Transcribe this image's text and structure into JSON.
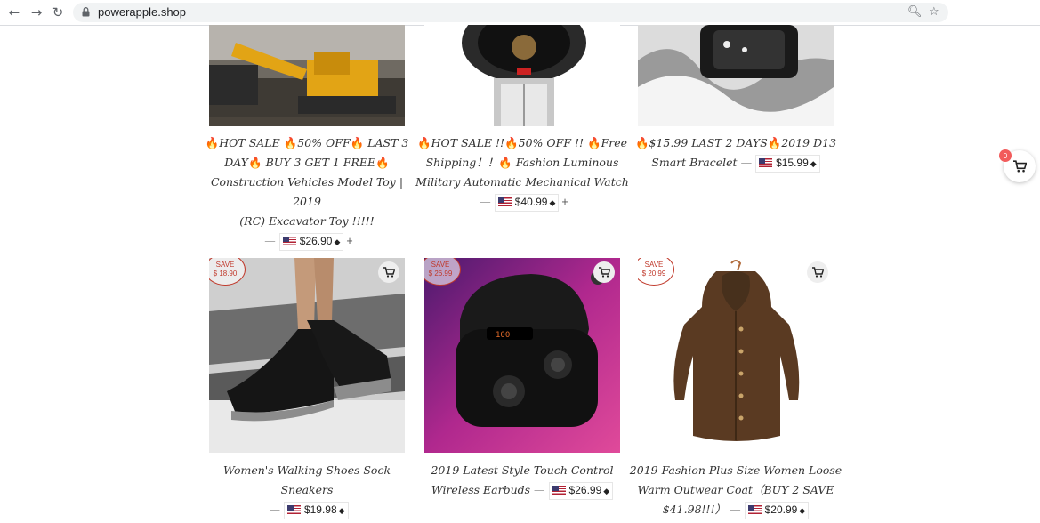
{
  "browser": {
    "url": "powerapple.shop"
  },
  "cart": {
    "count": "0"
  },
  "products": [
    {
      "title": "HOT SALE 50% OFF LAST 3 DAY BUY 3 GET 1 FREE Construction Vehicles Model Toy | 2019 (RC) Excavator Toy !!!!!",
      "title_parts": [
        "HOT SALE ",
        "50% OFF",
        " LAST 3",
        "DAY",
        " BUY 3 GET 1 FREE",
        "Construction Vehicles Model Toy | 2019",
        "(RC) Excavator Toy !!!!!"
      ],
      "price": "$26.90",
      "image": "excavator-toy"
    },
    {
      "title": "HOT SALE !!50% OFF !! Free Shipping！！ Fashion Luminous Military Automatic Mechanical Watch",
      "title_parts": [
        "HOT SALE !!",
        "50% OFF !! ",
        "Free",
        "Shipping！！",
        " Fashion Luminous",
        "Military Automatic Mechanical Watch"
      ],
      "price": "$40.99",
      "image": "mechanical-watch"
    },
    {
      "title": "$15.99 LAST 2 DAYS 2019 D13 Smart Bracelet",
      "title_parts": [
        "$15.99 LAST 2 DAYS",
        "2019 D13",
        "Smart Bracelet"
      ],
      "price": "$15.99",
      "image": "smart-bracelet"
    },
    {
      "title": "Women's Walking Shoes Sock Sneakers",
      "price": "$19.98",
      "save_label": "SAVE",
      "save_amount": "$ 18.90",
      "image": "sock-sneakers"
    },
    {
      "title_line1": "2019 Latest Style Touch Control",
      "title_line2": "Wireless Earbuds",
      "price": "$26.99",
      "save_label": "SAVE",
      "save_amount": "$ 26.99",
      "image": "wireless-earbuds"
    },
    {
      "title_line1": "2019 Fashion Plus Size Women Loose",
      "title_line2": "Warm Outwear Coat（BUY 2 SAVE",
      "title_line3": "$41.98!!!）",
      "price": "$20.99",
      "save_label": "SAVE",
      "save_amount": "$ 20.99",
      "image": "plush-coat"
    }
  ],
  "colors": {
    "save_badge": "#c0392b",
    "cart_badge": "#f25c5c",
    "fire_emoji": "#e8740c"
  }
}
